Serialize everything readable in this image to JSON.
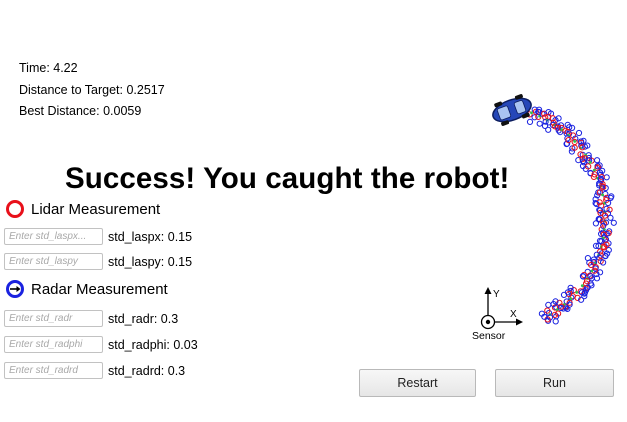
{
  "stats": {
    "time": "Time: 4.22",
    "distance": "Distance to Target: 0.2517",
    "best": "Best Distance: 0.0059"
  },
  "banner": "Success! You caught the robot!",
  "lidar": {
    "legend": "Lidar Measurement",
    "fields": [
      {
        "placeholder": "Enter std_laspx...",
        "label": "std_laspx: 0.15"
      },
      {
        "placeholder": "Enter std_laspy",
        "label": "std_laspy: 0.15"
      }
    ]
  },
  "radar": {
    "legend": "Radar Measurement",
    "fields": [
      {
        "placeholder": "Enter std_radr",
        "label": "std_radr: 0.3"
      },
      {
        "placeholder": "Enter std_radphi",
        "label": "std_radphi: 0.03"
      },
      {
        "placeholder": "Enter std_radrd",
        "label": "std_radrd: 0.3"
      }
    ]
  },
  "sensor": {
    "label": "Sensor",
    "x_axis": "X",
    "y_axis": "Y"
  },
  "buttons": {
    "restart": "Restart",
    "run": "Run"
  },
  "colors": {
    "lidar": "#e8101a",
    "radar": "#1a22e0",
    "estimate": "#2ec24a",
    "car": "#2547b8"
  }
}
